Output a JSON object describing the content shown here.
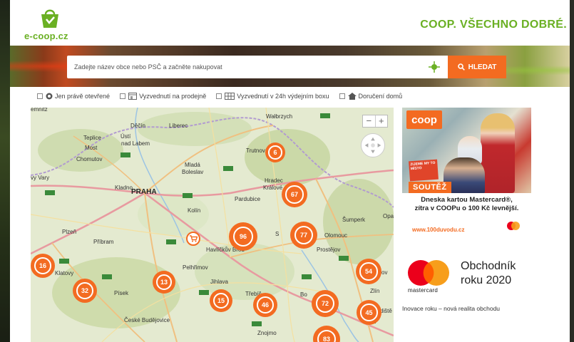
{
  "header": {
    "logo_text": "e-coop.cz",
    "slogan": "COOP. VŠECHNO DOBRÉ."
  },
  "search": {
    "placeholder": "Zadejte název obce nebo PSČ a začněte nakupovat",
    "button_label": "HLEDAT"
  },
  "filters": [
    {
      "label": "Jen právě otevřené",
      "icon": "clock-icon"
    },
    {
      "label": "Vyzvednutí na prodejně",
      "icon": "shop-icon"
    },
    {
      "label": "Vyzvednutí v 24h výdejním boxu",
      "icon": "locker-box-icon"
    },
    {
      "label": "Doručení domů",
      "icon": "home-icon"
    }
  ],
  "map": {
    "zoom_in": "+",
    "zoom_out": "−",
    "cities": [
      {
        "name": "Děčín"
      },
      {
        "name": "Liberec"
      },
      {
        "name": "Teplice"
      },
      {
        "name": "Ústí"
      },
      {
        "name": "nad Labem"
      },
      {
        "name": "Most"
      },
      {
        "name": "Chomutov"
      },
      {
        "name": "Wałbrzych"
      },
      {
        "name": "Trutnov"
      },
      {
        "name": "Mladá"
      },
      {
        "name": "Boleslav"
      },
      {
        "name": "Hradec"
      },
      {
        "name": "Králové"
      },
      {
        "name": "Kladno"
      },
      {
        "name": "PRAHA"
      },
      {
        "name": "Pardubice"
      },
      {
        "name": "Kolín"
      },
      {
        "name": "Plzeň"
      },
      {
        "name": "Příbram"
      },
      {
        "name": "Havlíčkův Brod"
      },
      {
        "name": "Šumperk"
      },
      {
        "name": "Olomouc"
      },
      {
        "name": "Prostějov"
      },
      {
        "name": "Pelhřimov"
      },
      {
        "name": "Jihlava"
      },
      {
        "name": "Klatovy"
      },
      {
        "name": "Písek"
      },
      {
        "name": "Třebíč"
      },
      {
        "name": "Zlín"
      },
      {
        "name": "Hradiště"
      },
      {
        "name": "České Budějovice"
      },
      {
        "name": "Znojmo"
      },
      {
        "name": "Opa"
      },
      {
        "name": "vy Vary"
      },
      {
        "name": "emnitz"
      },
      {
        "name": "Bo"
      },
      {
        "name": "ov"
      },
      {
        "name": "S"
      }
    ],
    "clusters": [
      {
        "count": "6"
      },
      {
        "count": "67"
      },
      {
        "count": "96"
      },
      {
        "count": "77"
      },
      {
        "count": "16"
      },
      {
        "count": "54"
      },
      {
        "count": "32"
      },
      {
        "count": "13"
      },
      {
        "count": "15"
      },
      {
        "count": "46"
      },
      {
        "count": "72"
      },
      {
        "count": "45"
      },
      {
        "count": "83"
      }
    ]
  },
  "ad_coop": {
    "logo": "coop",
    "box_text": "ZIJEME MY TO MÍSTO",
    "badge": "SOUTĚŽ",
    "line1": "Dneska kartou Mastercard®,",
    "line2": "zítra v COOPu o 100 Kč levnější.",
    "url": "www.100duvodu.cz"
  },
  "ad_mastercard": {
    "brand": "mastercard",
    "award_line1": "Obchodník",
    "award_line2": "roku 2020",
    "footer": "Inovace roku – nová realita obchodu"
  },
  "colors": {
    "brand_green": "#6ab023",
    "accent_orange": "#f36b21"
  }
}
